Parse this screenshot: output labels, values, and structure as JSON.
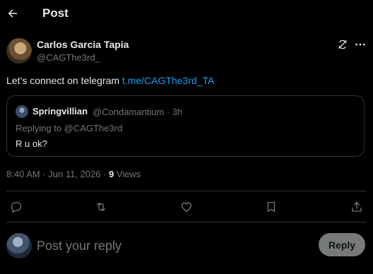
{
  "header": {
    "title": "Post"
  },
  "author": {
    "name": "Carlos Garcia Tapia",
    "handle": "@CAGThe3rd_"
  },
  "tweet": {
    "text_prefix": "Let’s connect on telegram ",
    "link_text": "t.me/CAGThe3rd_TA"
  },
  "quote": {
    "name": "Springvillian",
    "handle_time": "@Condamantium · 3h",
    "replying_to": "Replying to @CAGThe3rd",
    "text": "R u ok?"
  },
  "meta": {
    "timestamp": "8:40 AM · Jun 11, 2026 · ",
    "views_count": "9",
    "views_label": " Views"
  },
  "actions": [
    "reply-icon",
    "repost-icon",
    "like-icon",
    "bookmark-icon",
    "share-icon"
  ],
  "composer": {
    "placeholder": "Post your reply",
    "button_label": "Reply"
  },
  "colors": {
    "background": "#000000",
    "text": "#e7e9ea",
    "muted": "#71767b",
    "link": "#1d9bf0",
    "border": "#2f3336",
    "reply_button": "#787a7a"
  }
}
